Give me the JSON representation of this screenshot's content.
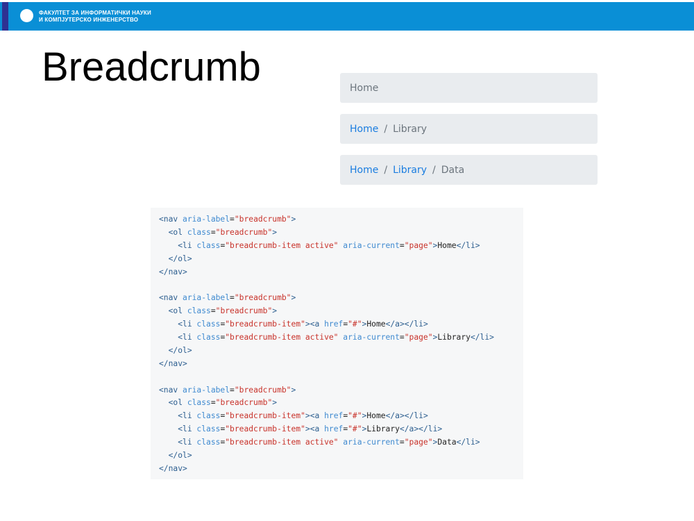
{
  "header": {
    "line1": "ФАКУЛТЕТ ЗА ИНФОРМАТИЧКИ НАУКИ",
    "line2": "И КОМПЈУТЕРСКО ИНЖЕНЕРСТВО"
  },
  "slide": {
    "title": "Breadcrumb"
  },
  "breadcrumbs": [
    {
      "items": [
        {
          "label": "Home",
          "active": true
        }
      ]
    },
    {
      "items": [
        {
          "label": "Home",
          "active": false
        },
        {
          "label": "Library",
          "active": true
        }
      ]
    },
    {
      "items": [
        {
          "label": "Home",
          "active": false
        },
        {
          "label": "Library",
          "active": false
        },
        {
          "label": "Data",
          "active": true
        }
      ]
    }
  ],
  "separator": "/",
  "colors": {
    "header_blue": "#0a8fd6",
    "header_accent": "#2e3192",
    "link": "#1a7de0",
    "breadcrumb_bg": "#e9ecef"
  },
  "code_lines": [
    "<nav aria-label=\"breadcrumb\">",
    "  <ol class=\"breadcrumb\">",
    "    <li class=\"breadcrumb-item active\" aria-current=\"page\">Home</li>",
    "  </ol>",
    "</nav>",
    "",
    "<nav aria-label=\"breadcrumb\">",
    "  <ol class=\"breadcrumb\">",
    "    <li class=\"breadcrumb-item\"><a href=\"#\">Home</a></li>",
    "    <li class=\"breadcrumb-item active\" aria-current=\"page\">Library</li>",
    "  </ol>",
    "</nav>",
    "",
    "<nav aria-label=\"breadcrumb\">",
    "  <ol class=\"breadcrumb\">",
    "    <li class=\"breadcrumb-item\"><a href=\"#\">Home</a></li>",
    "    <li class=\"breadcrumb-item\"><a href=\"#\">Library</a></li>",
    "    <li class=\"breadcrumb-item active\" aria-current=\"page\">Data</li>",
    "  </ol>",
    "</nav>"
  ]
}
